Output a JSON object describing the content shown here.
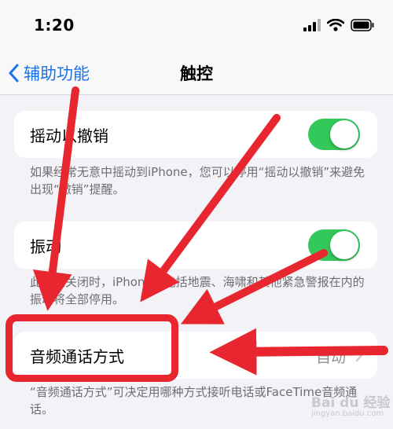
{
  "status": {
    "time": "1:20"
  },
  "nav": {
    "back_label": "辅助功能",
    "title": "触控"
  },
  "shake": {
    "label": "摇动以撤销",
    "toggle_on": true,
    "footnote": "如果经常无意中摇动到iPhone，您可以停用“摇动以撤销”来避免出现“撤销”提醒。"
  },
  "vibration": {
    "label": "振动",
    "toggle_on": true,
    "footnote": "此开关关闭时，iPhone上包括地震、海啸和其他紧急警报在内的振动将全部停用。"
  },
  "audio_call": {
    "label": "音频通话方式",
    "value": "自动",
    "footnote": "“音频通话方式”可决定用哪种方式接听电话或FaceTime音频通话。"
  },
  "colors": {
    "accent": "#1a73e8",
    "toggle": "#34c759",
    "annotation": "#e8262f"
  },
  "watermark": {
    "brand": "Bai du 经验",
    "url": "jingyan.baidu.com"
  }
}
